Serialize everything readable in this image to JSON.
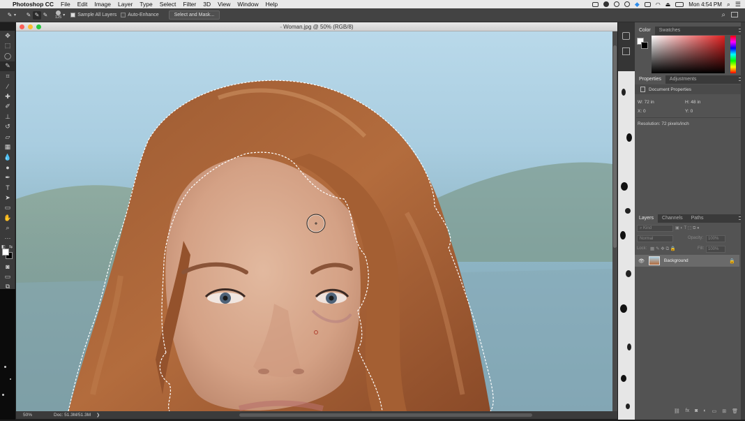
{
  "menubar": {
    "app": "Photoshop CC",
    "items": [
      "File",
      "Edit",
      "Image",
      "Layer",
      "Type",
      "Select",
      "Filter",
      "3D",
      "View",
      "Window",
      "Help"
    ],
    "clock": "Mon 4:54 PM"
  },
  "options": {
    "brush_size": "125",
    "sample_all_layers": "Sample All Layers",
    "auto_enhance": "Auto-Enhance",
    "select_mask": "Select and Mask..."
  },
  "document": {
    "title": "Woman.jpg @ 50% (RGB/8)",
    "zoom": "50%",
    "doc_size": "Doc: 51.3M/51.3M"
  },
  "color_panel": {
    "tabs": [
      "Color",
      "Swatches"
    ]
  },
  "properties_panel": {
    "tabs": [
      "Properties",
      "Adjustments"
    ],
    "heading": "Document Properties",
    "w": "W:  72 in",
    "h": "H:  48 in",
    "x": "X:  0",
    "y": "Y:  0",
    "resolution": "Resolution: 72 pixels/inch"
  },
  "layers_panel": {
    "tabs": [
      "Layers",
      "Channels",
      "Paths"
    ],
    "filter_placeholder": "Kind",
    "blend_mode": "Normal",
    "opacity_label": "Opacity:",
    "opacity_value": "100%",
    "lock_label": "Lock:",
    "fill_label": "Fill:",
    "fill_value": "100%",
    "layer_name": "Background"
  },
  "colors": {
    "accent": "#2d8ceb",
    "panel": "#535353",
    "dark": "#3a3a3a"
  }
}
